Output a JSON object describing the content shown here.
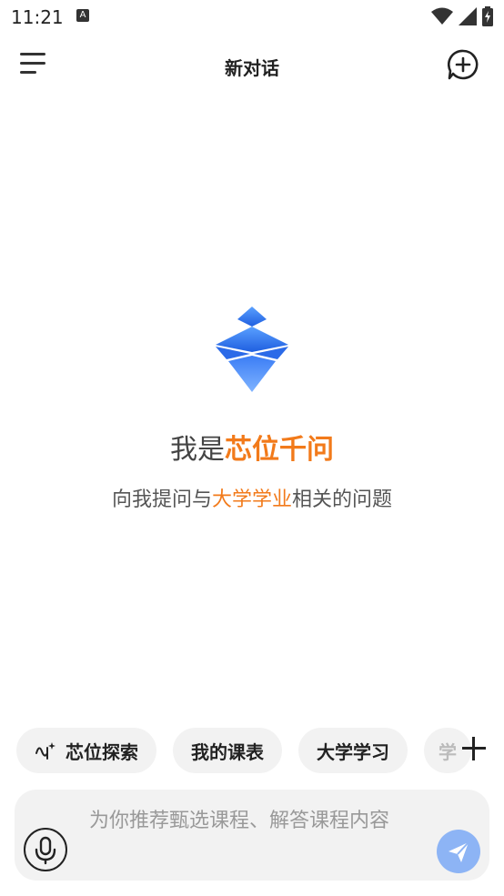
{
  "status": {
    "time": "11:21",
    "notif_letter": "A"
  },
  "header": {
    "title": "新对话"
  },
  "hero": {
    "intro_prefix": "我是",
    "intro_name": "芯位千问",
    "sub_prefix": "向我提问与",
    "sub_highlight": "大学学业",
    "sub_suffix": "相关的问题"
  },
  "chips": [
    {
      "label": "芯位探索",
      "icon": "sparkle-wave-icon"
    },
    {
      "label": "我的课表"
    },
    {
      "label": "大学学习"
    },
    {
      "label": "学"
    }
  ],
  "input": {
    "placeholder": "为你推荐甄选课程、解答课程内容"
  },
  "colors": {
    "accent": "#f27a1a",
    "send": "#8db4f5",
    "brand": "#3a7df0"
  }
}
